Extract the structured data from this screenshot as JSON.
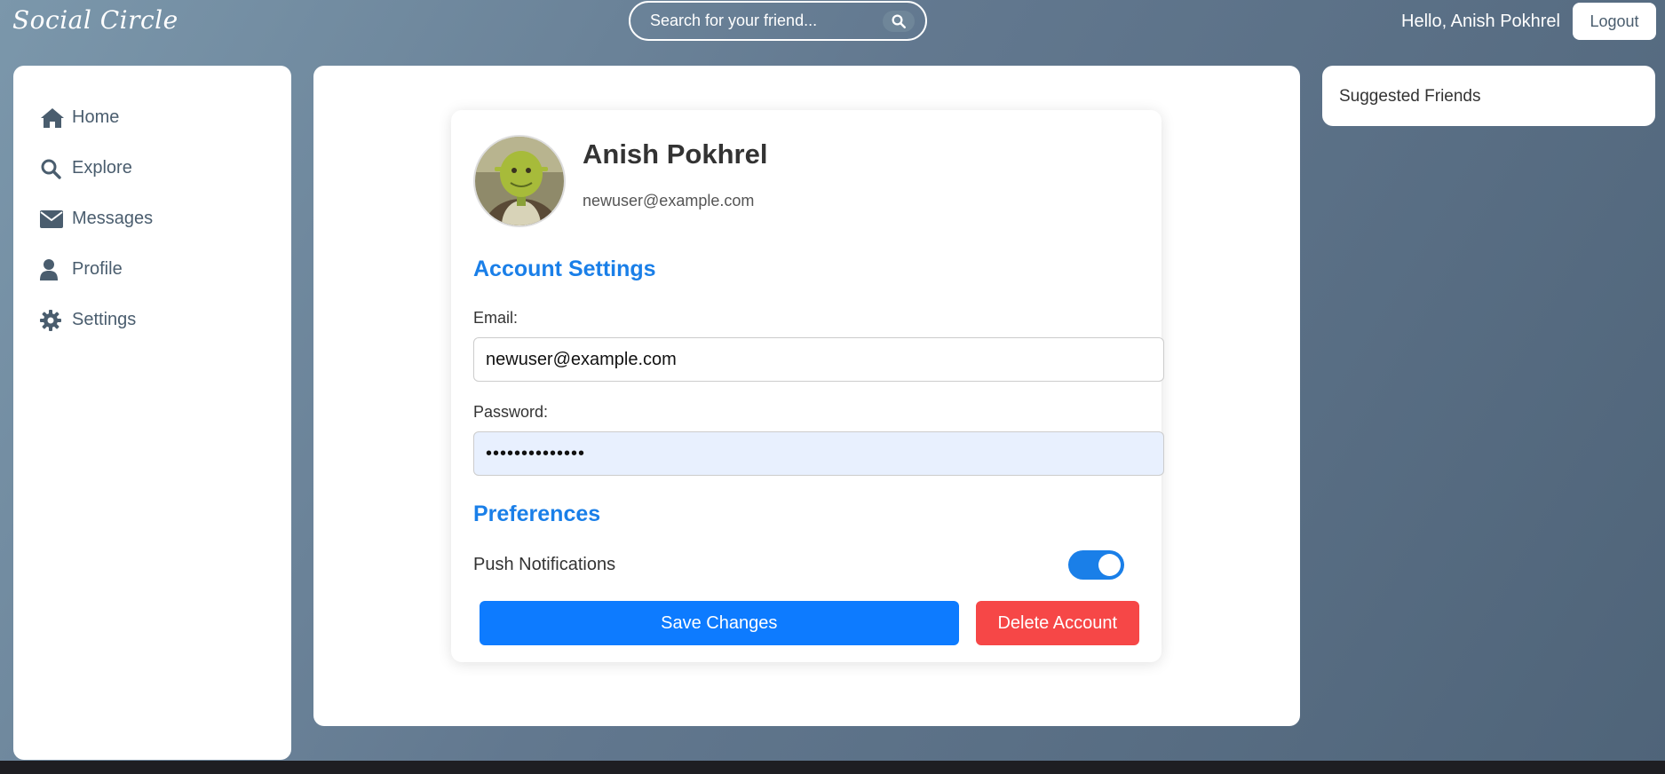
{
  "app": {
    "brand": "Social Circle"
  },
  "header": {
    "search_placeholder": "Search for your friend...",
    "greeting": "Hello, Anish Pokhrel",
    "logout_label": "Logout"
  },
  "sidebar": {
    "items": [
      {
        "label": "Home",
        "icon": "home-icon"
      },
      {
        "label": "Explore",
        "icon": "search-icon"
      },
      {
        "label": "Messages",
        "icon": "envelope-icon"
      },
      {
        "label": "Profile",
        "icon": "user-icon"
      },
      {
        "label": "Settings",
        "icon": "gear-icon"
      }
    ]
  },
  "profile": {
    "name": "Anish Pokhrel",
    "email": "newuser@example.com",
    "avatar": "shrek-avatar"
  },
  "account_settings": {
    "title": "Account Settings",
    "email_label": "Email:",
    "email_value": "newuser@example.com",
    "password_label": "Password:",
    "password_value": "••••••••••••••"
  },
  "preferences": {
    "title": "Preferences",
    "push_notifications_label": "Push Notifications",
    "push_notifications_enabled": true
  },
  "actions": {
    "save_label": "Save Changes",
    "delete_label": "Delete Account"
  },
  "right_panel": {
    "title": "Suggested Friends"
  },
  "colors": {
    "accent": "#1a7fe8",
    "save": "#0d7bff",
    "danger": "#f64747",
    "nav_text": "#4a5d6e"
  }
}
